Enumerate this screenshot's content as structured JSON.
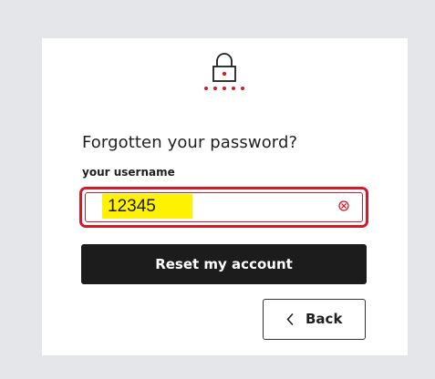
{
  "form": {
    "title": "Forgotten your password?",
    "username_label": "your username",
    "username_value": "12345",
    "reset_button_label": "Reset my account",
    "back_button_label": "Back"
  },
  "icons": {
    "lock": "lock-icon",
    "clear": "clear-circle-x-icon",
    "back": "chevron-left-icon"
  },
  "colors": {
    "page_background": "#e4e6ea",
    "card_background": "#ffffff",
    "accent_red": "#d01c2a",
    "primary_button": "#1c1c1c",
    "highlight_yellow": "#fff200"
  }
}
